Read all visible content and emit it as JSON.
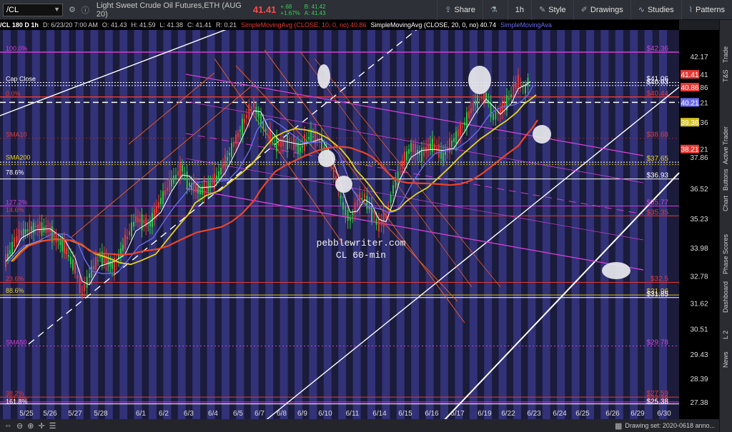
{
  "topbar": {
    "symbol": "/CL",
    "description": "Light Sweet Crude Oil Futures,ETH (AUG 20)",
    "last": "41.41",
    "change_abs": "+.68",
    "change_pct": "+1.67%",
    "bid": "B: 41.42",
    "ask": "A: 41.43",
    "buttons": [
      {
        "label": "Share",
        "icon": "share-icon"
      },
      {
        "label": "",
        "icon": "flask-icon"
      },
      {
        "label": "1h",
        "icon": ""
      },
      {
        "label": "Style",
        "icon": "style-icon"
      },
      {
        "label": "Drawings",
        "icon": "pencil-icon"
      },
      {
        "label": "Studies",
        "icon": "studies-icon"
      },
      {
        "label": "Patterns",
        "icon": "patterns-icon"
      }
    ]
  },
  "studybar": {
    "header": "/CL 180 D 1h",
    "date": "D: 6/23/20 7:00 AM",
    "open": "O: 41.43",
    "high": "H: 41.59",
    "low": "L: 41.38",
    "close": "C: 41.41",
    "range": "R: 0.21",
    "sma10_label": "SimpleMovingAvg (CLOSE, 10, 0, no)",
    "sma10_value": "40.86",
    "sma20_label": "SimpleMovingAvg (CLOSE, 20, 0, no)",
    "sma20_value": "40.74",
    "sma_next": "SimpleMovingAva"
  },
  "price_axis": [
    "42.17",
    "41.41",
    "40.86",
    "40.21",
    "39.36",
    "38.21",
    "37.86",
    "36.52",
    "35.23",
    "33.98",
    "32.78",
    "31.62",
    "30.51",
    "29.43",
    "28.39",
    "27.38"
  ],
  "price_tags": [
    {
      "text": "41.41",
      "color": "#e53935"
    },
    {
      "text": "40.86",
      "color": "#e53935"
    },
    {
      "text": "40.21",
      "color": "#6a6af0"
    },
    {
      "text": "39.36",
      "color": "#d4c21a"
    },
    {
      "text": "38.21",
      "color": "#e53935"
    }
  ],
  "line_labels_right": [
    "$42.36",
    "$41.06",
    "$40.93",
    "$40.44",
    "$38.68",
    "$37.65",
    "$36.93",
    "$35.77",
    "$35.35",
    "$32.5",
    "$31.96",
    "$31.85",
    "$29.78",
    "$27.59",
    "$27.38",
    "$25.38"
  ],
  "line_labels_left": [
    "100.0%",
    "Cap Close",
    "0.0%",
    "SMA10",
    "SMA200",
    "78.6%",
    "127.2%",
    "14.6%",
    "23.6%",
    "88.6%",
    "SMA50",
    "38.2%",
    "161.8%",
    "161.8%"
  ],
  "x_axis": [
    "5/25",
    "5/26",
    "5/27",
    "5/28",
    "6/1",
    "6/2",
    "6/3",
    "6/4",
    "6/5",
    "6/7",
    "6/8",
    "6/9",
    "6/10",
    "6/11",
    "6/14",
    "6/15",
    "6/16",
    "6/17",
    "6/19",
    "6/22",
    "6/23",
    "6/24",
    "6/25",
    "6/26",
    "6/29",
    "6/30"
  ],
  "watermark": [
    "pebblewriter.com",
    "CL 60-min"
  ],
  "right_dock": [
    "Trade",
    "T&S",
    "Active Trader",
    "Buttons",
    "Chart",
    "Phase Scores",
    "Dashboard",
    "L 2",
    "News"
  ],
  "bottom": {
    "drawing_set": "Drawing set: 2020-0618 anno..."
  }
}
